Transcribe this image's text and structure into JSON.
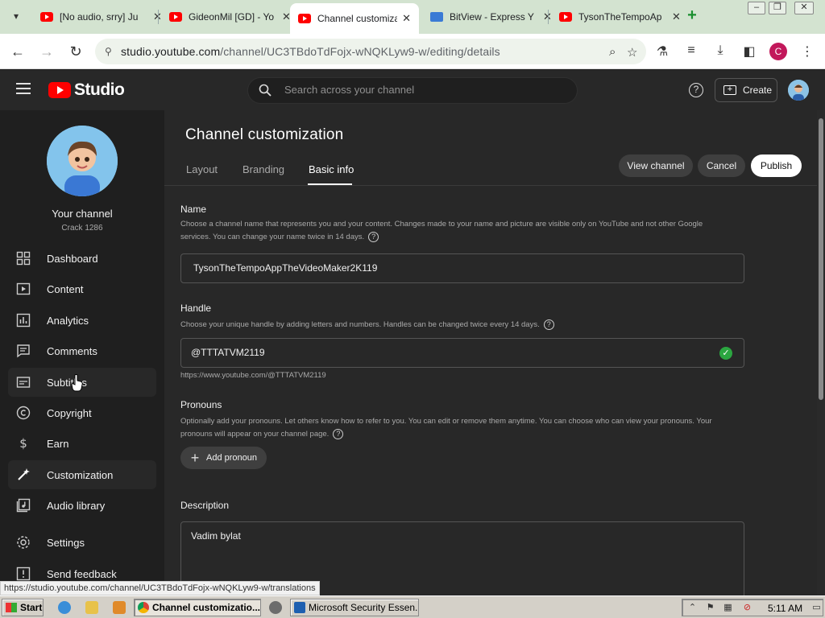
{
  "browser": {
    "tabs": [
      {
        "title": "[No audio, srry] Ju",
        "active": false
      },
      {
        "title": "GideonMil [GD] - Yo",
        "active": false
      },
      {
        "title": "Channel customiza",
        "active": true
      },
      {
        "title": "BitView - Express Y",
        "active": false
      },
      {
        "title": "TysonTheTempoAp",
        "active": false
      }
    ],
    "new_tab": "+",
    "url_host": "studio.youtube.com",
    "url_path": "/channel/UC3TBdoTdFojx-wNQKLyw9-w/editing/details",
    "profile_letter": "C"
  },
  "studio": {
    "logo_text": "Studio",
    "search_placeholder": "Search across your channel",
    "help_glyph": "?",
    "create_label": "Create"
  },
  "sidebar": {
    "your_channel": "Your channel",
    "channel_name": "Crack 1286",
    "items": [
      {
        "label": "Dashboard",
        "icon": "dashboard-icon"
      },
      {
        "label": "Content",
        "icon": "content-icon"
      },
      {
        "label": "Analytics",
        "icon": "analytics-icon"
      },
      {
        "label": "Comments",
        "icon": "comments-icon"
      },
      {
        "label": "Subtitles",
        "icon": "subtitles-icon"
      },
      {
        "label": "Copyright",
        "icon": "copyright-icon"
      },
      {
        "label": "Earn",
        "icon": "earn-icon"
      },
      {
        "label": "Customization",
        "icon": "customization-icon"
      },
      {
        "label": "Audio library",
        "icon": "audio-library-icon"
      },
      {
        "label": "Settings",
        "icon": "settings-icon"
      },
      {
        "label": "Send feedback",
        "icon": "feedback-icon"
      }
    ]
  },
  "main": {
    "title": "Channel customization",
    "tabs": [
      {
        "label": "Layout"
      },
      {
        "label": "Branding"
      },
      {
        "label": "Basic info"
      }
    ],
    "view_channel": "View channel",
    "cancel": "Cancel",
    "publish": "Publish",
    "name": {
      "title": "Name",
      "desc": "Choose a channel name that represents you and your content. Changes made to your name and picture are visible only on YouTube and not other Google services. You can change your name twice in 14 days.",
      "value": "TysonTheTempoAppTheVideoMaker2K119"
    },
    "handle": {
      "title": "Handle",
      "desc": "Choose your unique handle by adding letters and numbers. Handles can be changed twice every 14 days.",
      "value": "@TTTATVM2119",
      "url": "https://www.youtube.com/@TTTATVM2119"
    },
    "pronouns": {
      "title": "Pronouns",
      "desc": "Optionally add your pronouns. Let others know how to refer to you. You can edit or remove them anytime. You can choose who can view your pronouns. Your pronouns will appear on your channel page.",
      "add_label": "Add pronoun"
    },
    "description": {
      "title": "Description",
      "value": "Vadim bylat"
    }
  },
  "status_url": "https://studio.youtube.com/channel/UC3TBdoTdFojx-wNQKLyw9-w/translations",
  "taskbar": {
    "start": "Start",
    "tasks": [
      {
        "label": "Channel customizatio...",
        "pressed": true
      },
      {
        "label": "Microsoft Security Essen...",
        "pressed": false
      }
    ],
    "clock": "5:11 AM"
  },
  "colors": {
    "accent_red": "#ff0000",
    "check_green": "#2ba640",
    "bg_main": "#282828",
    "bg_sidebar": "#1f1f1f"
  }
}
